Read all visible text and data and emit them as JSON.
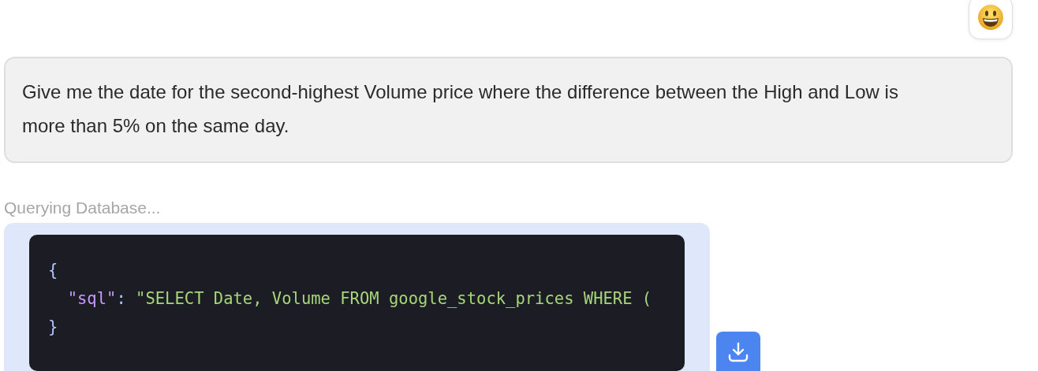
{
  "user_avatar": {
    "kind": "emoji"
  },
  "user_message": {
    "text": "Give me the date for the second-highest Volume price where the difference between the High and Low is more than 5% on the same day."
  },
  "status": "Querying Database...",
  "code_block": {
    "lines": [
      {
        "indent": false,
        "tokens": [
          {
            "kind": "punct",
            "text": "{"
          }
        ]
      },
      {
        "indent": true,
        "tokens": [
          {
            "kind": "key",
            "text": "\"sql\""
          },
          {
            "kind": "punct",
            "text": ": "
          },
          {
            "kind": "string",
            "text": "\"SELECT Date, Volume FROM google_stock_prices WHERE ("
          }
        ]
      },
      {
        "indent": false,
        "tokens": [
          {
            "kind": "punct",
            "text": "}"
          }
        ]
      }
    ]
  },
  "download_button": {
    "kind": "download"
  }
}
